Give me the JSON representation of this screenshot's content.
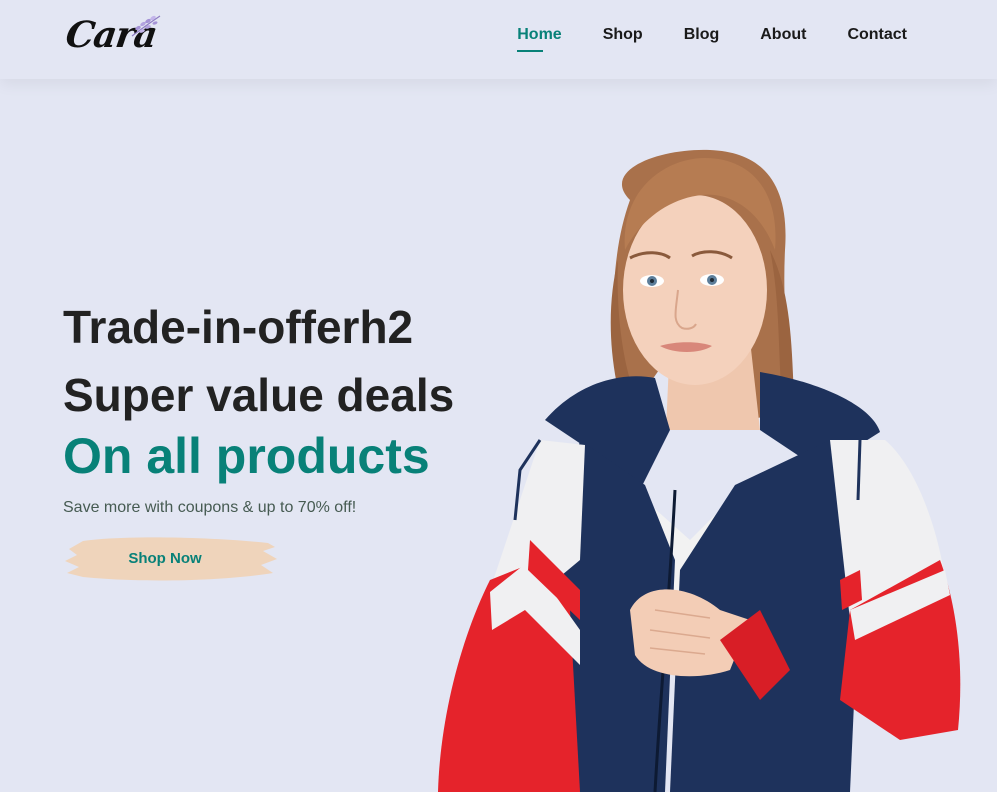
{
  "brand": {
    "logo_text": "Cara"
  },
  "nav": {
    "items": [
      {
        "label": "Home",
        "active": true
      },
      {
        "label": "Shop",
        "active": false
      },
      {
        "label": "Blog",
        "active": false
      },
      {
        "label": "About",
        "active": false
      },
      {
        "label": "Contact",
        "active": false
      }
    ]
  },
  "hero": {
    "offer": "Trade-in-offerh2",
    "title": "Super value deals",
    "accent": "On all products",
    "subtitle": "Save more with coupons & up to 70% off!",
    "cta_label": "Shop Now"
  },
  "colors": {
    "background": "#e3e6f3",
    "accent": "#088178",
    "heading": "#222222",
    "button_brush": "#efd4bb"
  }
}
